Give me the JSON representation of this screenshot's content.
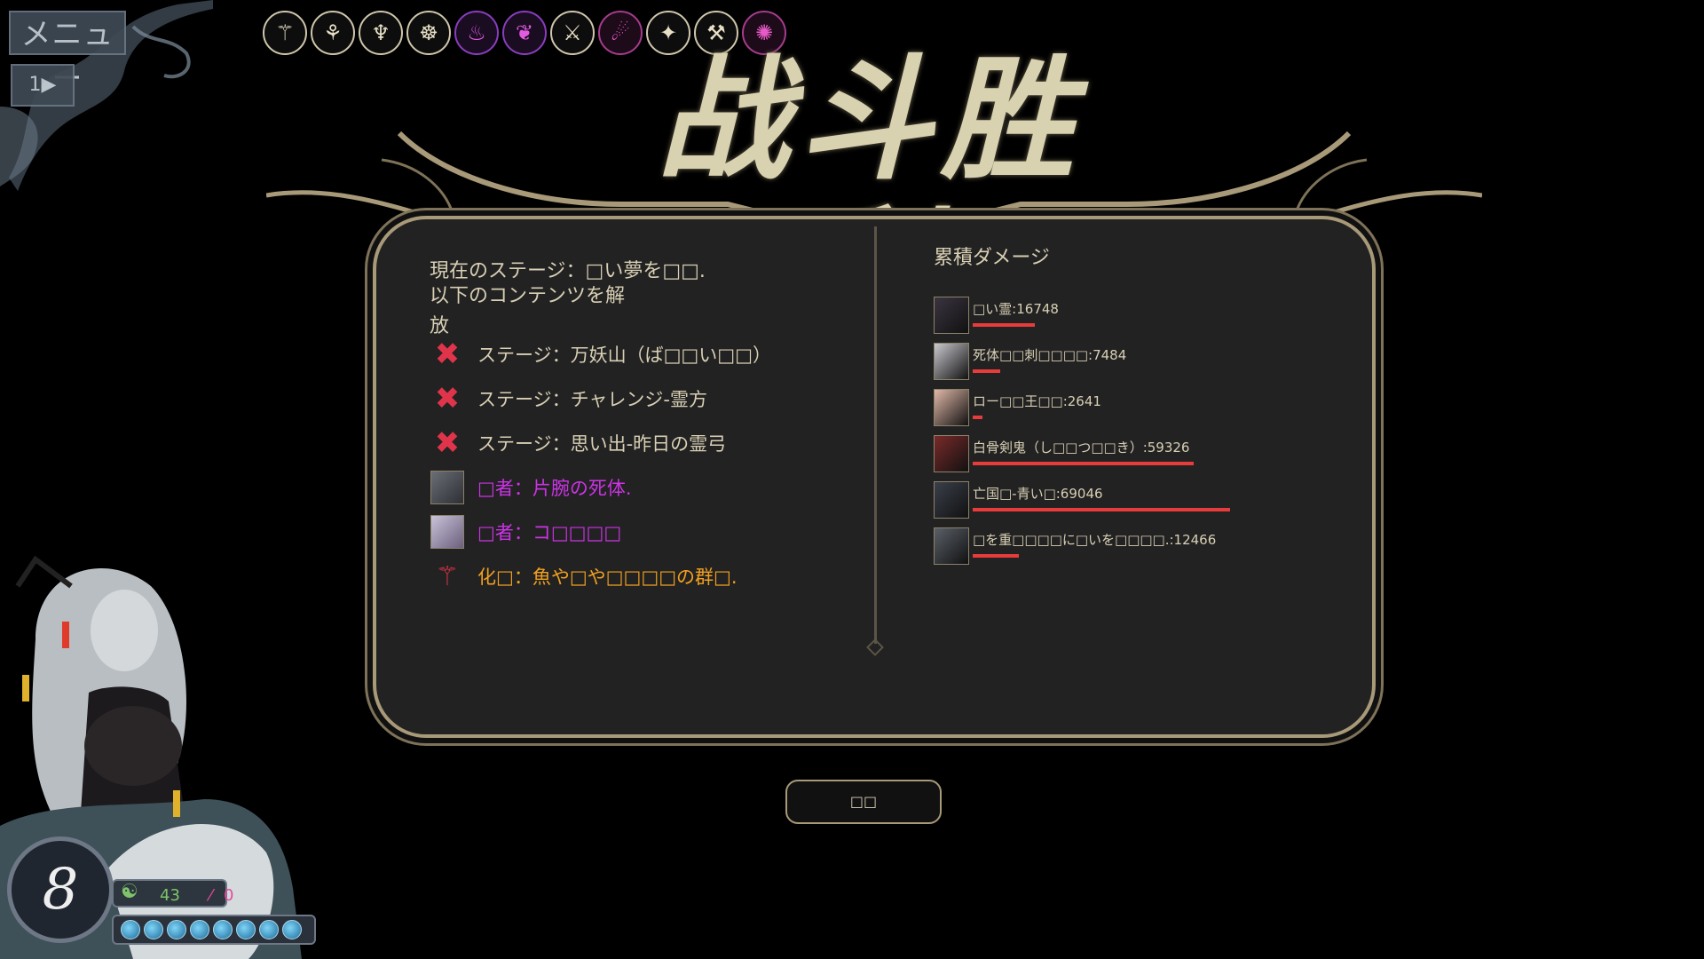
{
  "topbar": {
    "menu_label": "メニュー",
    "speed_label": "1▶",
    "relic_icons": [
      {
        "name": "relic-1-icon",
        "glyph": "⚚",
        "style": "n"
      },
      {
        "name": "relic-2-icon",
        "glyph": "⚘",
        "style": "n"
      },
      {
        "name": "relic-3-icon",
        "glyph": "♆",
        "style": "n"
      },
      {
        "name": "relic-4-icon",
        "glyph": "☸",
        "style": "n"
      },
      {
        "name": "relic-5-icon",
        "glyph": "♨",
        "style": "p"
      },
      {
        "name": "relic-6-icon",
        "glyph": "❦",
        "style": "p"
      },
      {
        "name": "relic-7-icon",
        "glyph": "⚔",
        "style": "n"
      },
      {
        "name": "relic-8-icon",
        "glyph": "☄",
        "style": "m"
      },
      {
        "name": "relic-9-icon",
        "glyph": "✦",
        "style": "n"
      },
      {
        "name": "relic-10-icon",
        "glyph": "⚒",
        "style": "n"
      },
      {
        "name": "relic-11-icon",
        "glyph": "✺",
        "style": "m"
      }
    ]
  },
  "title": "战斗胜利",
  "left": {
    "stage_line1": "現在のステージ：□い夢を□□.",
    "stage_line2": "以下のコンテンツを解",
    "stage_line3": "放",
    "unlocks": [
      {
        "icon": "crossed-swords-icon",
        "text": "ステージ：万妖山（ば□□い□□）",
        "color": "normal"
      },
      {
        "icon": "crossed-swords-icon",
        "text": "ステージ：チャレンジ-霊方",
        "color": "normal"
      },
      {
        "icon": "crossed-swords-icon",
        "text": "ステージ：思い出-昨日の霊弓",
        "color": "normal"
      },
      {
        "icon": "portrait-icon",
        "text": "□者：片腕の死体.",
        "color": "purple"
      },
      {
        "icon": "portrait-icon",
        "text": "□者：コ□□□□",
        "color": "purple"
      },
      {
        "icon": "figure-icon",
        "text": "化□：魚や□や□□□□の群□.",
        "color": "orange"
      }
    ]
  },
  "right": {
    "title": "累積ダメージ",
    "entries": [
      {
        "label": "□い霊:16748",
        "damage": 16748
      },
      {
        "label": "死体□□刺□□□□:7484",
        "damage": 7484
      },
      {
        "label": "ロー□□王□□:2641",
        "damage": 2641
      },
      {
        "label": "白骨剣鬼（し□□つ□□き）:59326",
        "damage": 59326
      },
      {
        "label": "亡国□-青い□:69046",
        "damage": 69046
      },
      {
        "label": "□を重□□□□に□いを□□□□.:12466",
        "damage": 12466
      }
    ]
  },
  "confirm_label": "□□",
  "hud": {
    "energy": "8",
    "green_value": "43",
    "pink_value": "0",
    "mana_count": 8
  },
  "colors": {
    "accent_gold": "#a89a78",
    "damage_bar": "#e83b3b",
    "purple_text": "#cc33e6",
    "orange_text": "#f0a020"
  }
}
